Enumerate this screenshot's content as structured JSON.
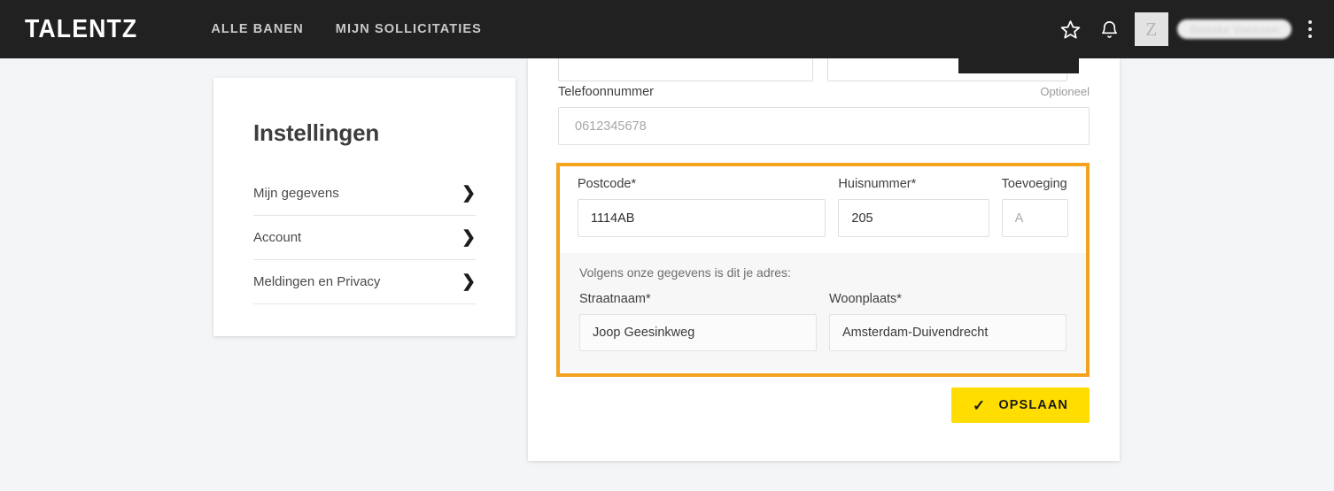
{
  "header": {
    "brand": "TALENTZ",
    "nav": [
      {
        "label": "ALLE BANEN",
        "name": "nav-alle-banen"
      },
      {
        "label": "MIJN SOLLICITATIES",
        "name": "nav-mijn-sollicitaties"
      }
    ],
    "favorites_icon": "star-icon",
    "notifications_icon": "bell-icon",
    "avatar_initial": "Z",
    "user_name": "Sietske Vaessen",
    "menu_icon": "kebab-menu-icon",
    "background_color": "#212121"
  },
  "sidebar": {
    "title": "Instellingen",
    "items": [
      {
        "label": "Mijn gegevens",
        "chevron": "chevron-right-icon"
      },
      {
        "label": "Account",
        "chevron": "chevron-right-icon"
      },
      {
        "label": "Meldingen en Privacy",
        "chevron": "chevron-right-icon"
      }
    ]
  },
  "form": {
    "phone": {
      "label": "Telefoonnummer",
      "optional_label": "Optioneel",
      "value": "",
      "placeholder": "0612345678"
    },
    "address": {
      "highlight_color": "#f5a21f",
      "postcode": {
        "label": "Postcode*",
        "value": "1114AB",
        "placeholder": ""
      },
      "huisnummer": {
        "label": "Huisnummer*",
        "value": "205",
        "placeholder": ""
      },
      "toevoeging": {
        "label": "Toevoeging",
        "value": "",
        "placeholder": "A"
      },
      "lookup_note": "Volgens onze gegevens is dit je adres:",
      "straatnaam": {
        "label": "Straatnaam*",
        "value": "Joop Geesinkweg"
      },
      "woonplaats": {
        "label": "Woonplaats*",
        "value": "Amsterdam-Duivendrecht"
      }
    },
    "save": {
      "label": "OPSLAAN",
      "icon": "check-icon",
      "color": "#ffdd00"
    }
  }
}
